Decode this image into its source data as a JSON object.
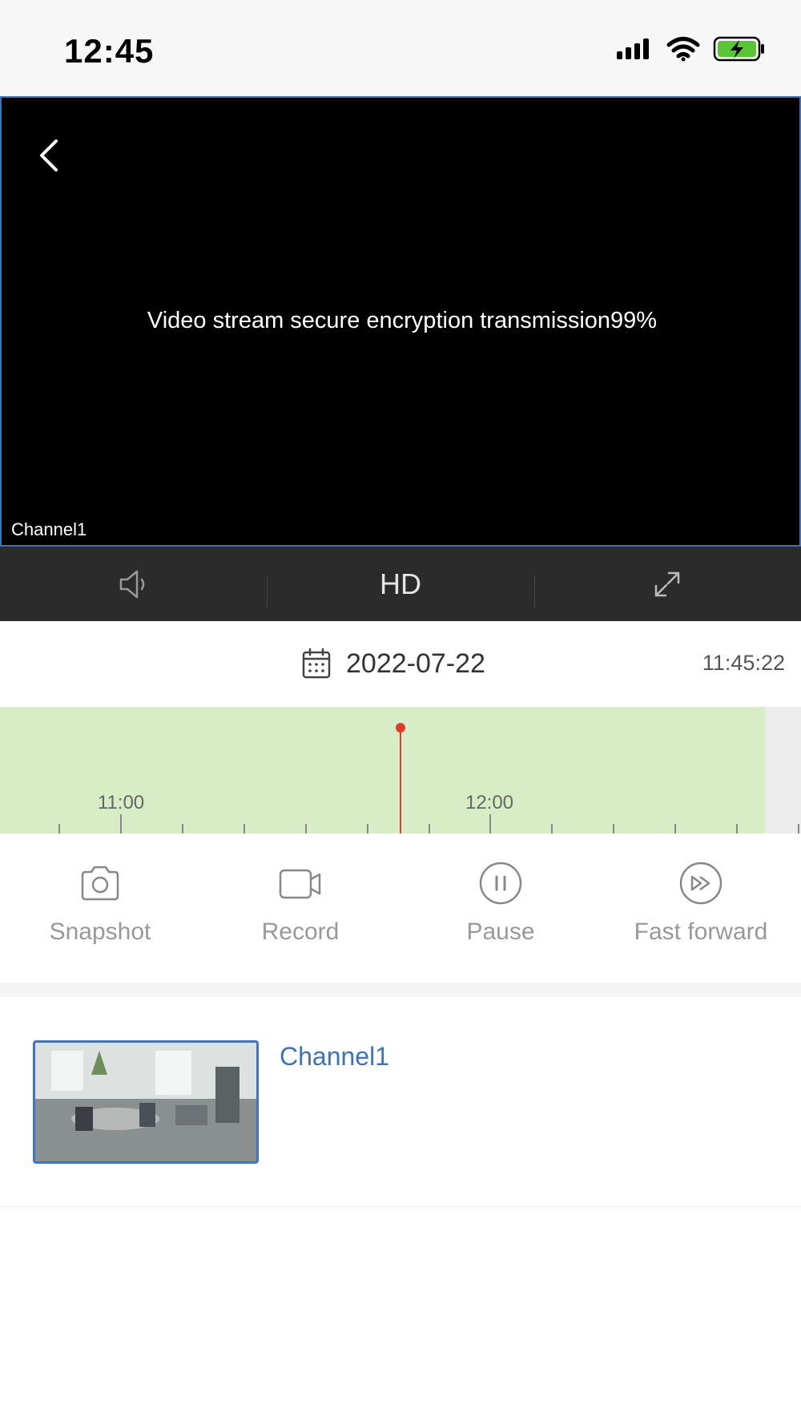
{
  "status_bar": {
    "time": "12:45"
  },
  "video": {
    "message": "Video stream secure encryption transmission99%",
    "channel_label": "Channel1"
  },
  "controls": {
    "quality": "HD"
  },
  "playback": {
    "date": "2022-07-22",
    "current_time": "11:45:22",
    "timeline_labels": [
      "11:00",
      "12:00"
    ]
  },
  "actions": [
    {
      "label": "Snapshot",
      "icon": "camera-icon"
    },
    {
      "label": "Record",
      "icon": "video-camera-icon"
    },
    {
      "label": "Pause",
      "icon": "pause-icon"
    },
    {
      "label": "Fast forward",
      "icon": "fast-forward-icon"
    }
  ],
  "channels": [
    {
      "name": "Channel1"
    }
  ],
  "colors": {
    "accent": "#3f73c4",
    "timeline_recorded": "#d7edc6",
    "cursor": "#e03a2a",
    "control_bar": "#2b2b2b"
  }
}
